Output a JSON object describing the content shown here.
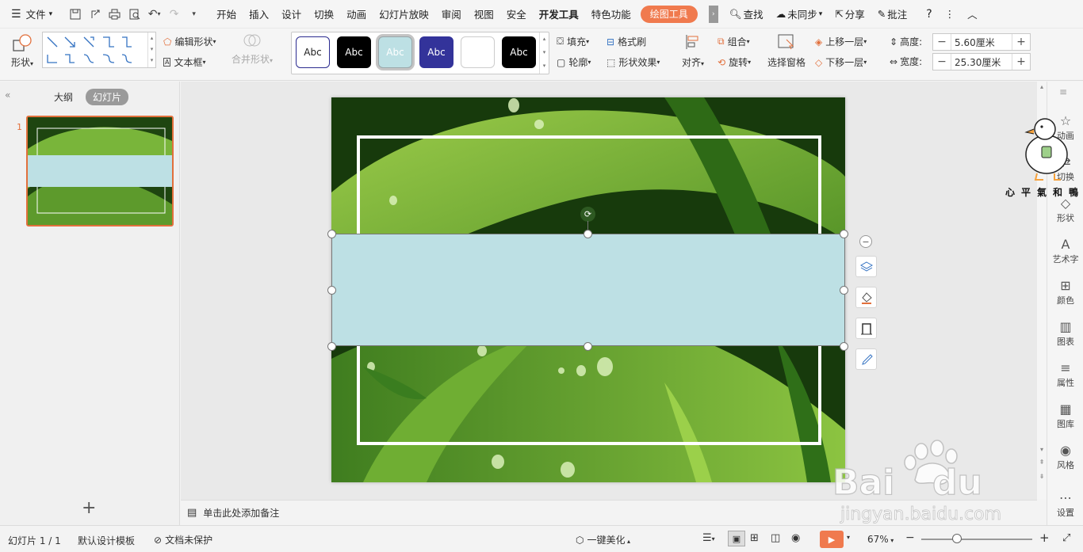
{
  "menubar": {
    "file_label": "文件",
    "tabs": [
      "开始",
      "插入",
      "设计",
      "切换",
      "动画",
      "幻灯片放映",
      "审阅",
      "视图",
      "安全",
      "开发工具",
      "特色功能"
    ],
    "active_tab": "绘图工具",
    "search_label": "查找",
    "sync_label": "未同步",
    "share_label": "分享",
    "comment_label": "批注",
    "help_label": "?"
  },
  "ribbon": {
    "shape_label": "形状",
    "edit_shape_label": "编辑形状",
    "textbox_label": "文本框",
    "merge_shape_label": "合并形状",
    "style_swatches": [
      {
        "label": "Abc",
        "bg": "#ffffff",
        "fg": "#222222",
        "border": "#2b2b8f"
      },
      {
        "label": "Abc",
        "bg": "#000000",
        "fg": "#ffffff",
        "border": "#000000"
      },
      {
        "label": "Abc",
        "bg": "#bde0e4",
        "fg": "#ffffff",
        "border": "#9aa7aa"
      },
      {
        "label": "Abc",
        "bg": "#33339a",
        "fg": "#ffffff",
        "border": "#33339a"
      },
      {
        "label": "",
        "bg": "#ffffff",
        "fg": "#222222",
        "border": "#cccccc"
      },
      {
        "label": "Abc",
        "bg": "#000000",
        "fg": "#ffffff",
        "border": "#000000"
      }
    ],
    "fill_label": "填充",
    "format_brush_label": "格式刷",
    "outline_label": "轮廓",
    "shape_effect_label": "形状效果",
    "align_label": "对齐",
    "group_label": "组合",
    "rotate_label": "旋转",
    "selection_pane_label": "选择窗格",
    "bring_forward_label": "上移一层",
    "send_backward_label": "下移一层",
    "height_label": "高度:",
    "height_value": "5.60厘米",
    "width_label": "宽度:",
    "width_value": "25.30厘米"
  },
  "leftpanel": {
    "outline_tab": "大纲",
    "slides_tab": "幻灯片",
    "slide_number": "1",
    "add_label": "+"
  },
  "notes": {
    "placeholder": "单击此处添加备注"
  },
  "rightpanel": {
    "items": [
      "动画",
      "切换",
      "形状",
      "艺术字",
      "颜色",
      "图表",
      "属性",
      "图库",
      "风格",
      "设置"
    ],
    "watermark": "心平氣和鴨"
  },
  "statusbar": {
    "slide_info": "幻灯片 1 / 1",
    "template": "默认设计模板",
    "protect": "文档未保护",
    "beautify": "一键美化",
    "zoom": "67%"
  },
  "colors": {
    "accent": "#f07a4e",
    "shape_fill": "#bde0e4",
    "leaf_dark": "#1f4a12",
    "leaf_light": "#7dbb3a"
  }
}
